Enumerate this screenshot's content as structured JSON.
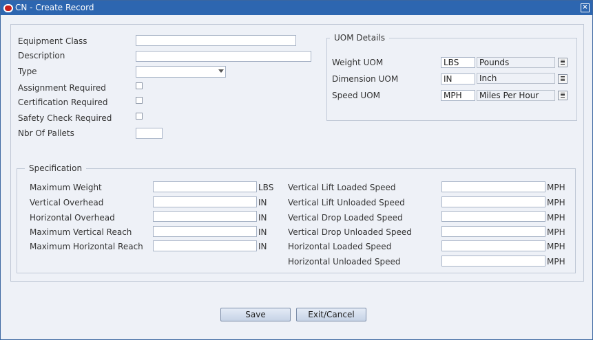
{
  "window": {
    "title": "CN - Create Record"
  },
  "form": {
    "equipment_class_label": "Equipment Class",
    "description_label": "Description",
    "type_label": "Type",
    "assignment_required_label": "Assignment Required",
    "certification_required_label": "Certification Required",
    "safety_check_required_label": "Safety Check Required",
    "nbr_of_pallets_label": "Nbr Of Pallets"
  },
  "uom": {
    "legend": "UOM Details",
    "weight_label": "Weight UOM",
    "weight_code": "LBS",
    "weight_desc": "Pounds",
    "dimension_label": "Dimension UOM",
    "dimension_code": "IN",
    "dimension_desc": "Inch",
    "speed_label": "Speed UOM",
    "speed_code": "MPH",
    "speed_desc": "Miles Per Hour"
  },
  "spec": {
    "legend": "Specification",
    "left": [
      {
        "label": "Maximum Weight",
        "unit": "LBS"
      },
      {
        "label": "Vertical Overhead",
        "unit": "IN"
      },
      {
        "label": "Horizontal Overhead",
        "unit": "IN"
      },
      {
        "label": "Maximum Vertical Reach",
        "unit": "IN"
      },
      {
        "label": "Maximum Horizontal Reach",
        "unit": "IN"
      }
    ],
    "right": [
      {
        "label": "Vertical Lift Loaded Speed",
        "unit": "MPH"
      },
      {
        "label": "Vertical Lift Unloaded Speed",
        "unit": "MPH"
      },
      {
        "label": "Vertical Drop Loaded Speed",
        "unit": "MPH"
      },
      {
        "label": "Vertical Drop Unloaded Speed",
        "unit": "MPH"
      },
      {
        "label": "Horizontal Loaded Speed",
        "unit": "MPH"
      },
      {
        "label": "Horizontal Unloaded Speed",
        "unit": "MPH"
      }
    ]
  },
  "buttons": {
    "save": "Save",
    "exit_cancel": "Exit/Cancel"
  }
}
